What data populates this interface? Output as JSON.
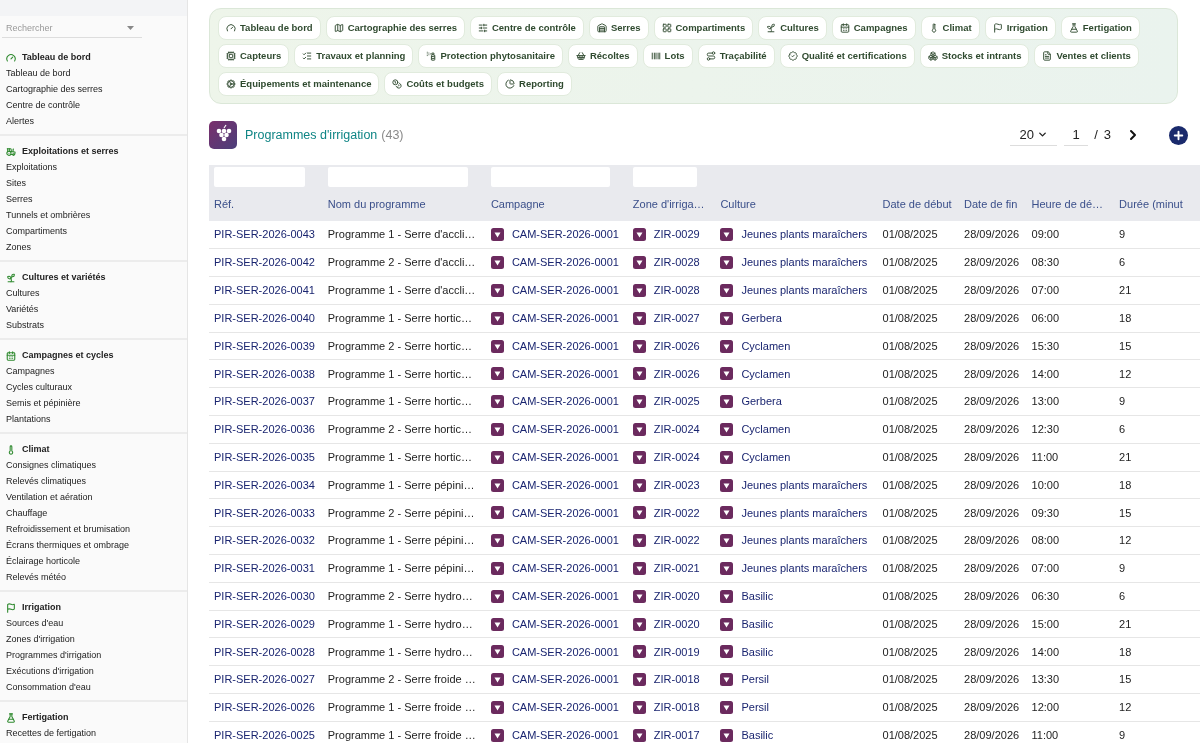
{
  "sidebar": {
    "search_placeholder": "Rechercher",
    "sections": [
      {
        "title": "Tableau de bord",
        "items": [
          "Tableau de bord",
          "Cartographie des serres",
          "Centre de contrôle",
          "Alertes"
        ]
      },
      {
        "title": "Exploitations et serres",
        "items": [
          "Exploitations",
          "Sites",
          "Serres",
          "Tunnels et ombrières",
          "Compartiments",
          "Zones"
        ]
      },
      {
        "title": "Cultures et variétés",
        "items": [
          "Cultures",
          "Variétés",
          "Substrats"
        ]
      },
      {
        "title": "Campagnes et cycles",
        "items": [
          "Campagnes",
          "Cycles culturaux",
          "Semis et pépinière",
          "Plantations"
        ]
      },
      {
        "title": "Climat",
        "items": [
          "Consignes climatiques",
          "Relevés climatiques",
          "Ventilation et aération",
          "Chauffage",
          "Refroidissement et brumisation",
          "Écrans thermiques et ombrage",
          "Éclairage horticole",
          "Relevés météo"
        ]
      },
      {
        "title": "Irrigation",
        "items": [
          "Sources d'eau",
          "Zones d'irrigation",
          "Programmes d'irrigation",
          "Exécutions d'irrigation",
          "Consommation d'eau"
        ]
      },
      {
        "title": "Fertigation",
        "items": [
          "Recettes de fertigation"
        ]
      }
    ]
  },
  "nav_pills": [
    "Tableau de bord",
    "Cartographie des serres",
    "Centre de contrôle",
    "Serres",
    "Compartiments",
    "Cultures",
    "Campagnes",
    "Climat",
    "Irrigation",
    "Fertigation",
    "Capteurs",
    "Travaux et planning",
    "Protection phytosanitaire",
    "Récoltes",
    "Lots",
    "Traçabilité",
    "Qualité et certifications",
    "Stocks et intrants",
    "Ventes et clients",
    "Équipements et maintenance",
    "Coûts et budgets",
    "Reporting"
  ],
  "page": {
    "title": "Programmes d'irrigation",
    "count": "(43)",
    "page_size": "20",
    "page": "1",
    "separator": "/",
    "total_pages": "3"
  },
  "table": {
    "columns": [
      {
        "label": "Réf.",
        "filter": true
      },
      {
        "label": "Nom du programme",
        "filter": true
      },
      {
        "label": "Campagne",
        "filter": true
      },
      {
        "label": "Zone d'irriga…",
        "filter": true
      },
      {
        "label": "Culture",
        "filter": false
      },
      {
        "label": "Date de début",
        "filter": false
      },
      {
        "label": "Date de fin",
        "filter": false
      },
      {
        "label": "Heure de dé…",
        "filter": false
      },
      {
        "label": "Durée (minut",
        "filter": false
      }
    ],
    "rows": [
      {
        "ref": "PIR-SER-2026-0043",
        "name": "Programme 1 - Serre d'accli…",
        "campaign": "CAM-SER-2026-0001",
        "zone": "ZIR-0029",
        "culture": "Jeunes plants maraîchers",
        "start": "01/08/2025",
        "end": "28/09/2026",
        "time": "09:00",
        "duration": "9"
      },
      {
        "ref": "PIR-SER-2026-0042",
        "name": "Programme 2 - Serre d'accli…",
        "campaign": "CAM-SER-2026-0001",
        "zone": "ZIR-0028",
        "culture": "Jeunes plants maraîchers",
        "start": "01/08/2025",
        "end": "28/09/2026",
        "time": "08:30",
        "duration": "6"
      },
      {
        "ref": "PIR-SER-2026-0041",
        "name": "Programme 1 - Serre d'accli…",
        "campaign": "CAM-SER-2026-0001",
        "zone": "ZIR-0028",
        "culture": "Jeunes plants maraîchers",
        "start": "01/08/2025",
        "end": "28/09/2026",
        "time": "07:00",
        "duration": "21"
      },
      {
        "ref": "PIR-SER-2026-0040",
        "name": "Programme 1 - Serre hortic…",
        "campaign": "CAM-SER-2026-0001",
        "zone": "ZIR-0027",
        "culture": "Gerbera",
        "start": "01/08/2025",
        "end": "28/09/2026",
        "time": "06:00",
        "duration": "18"
      },
      {
        "ref": "PIR-SER-2026-0039",
        "name": "Programme 2 - Serre hortic…",
        "campaign": "CAM-SER-2026-0001",
        "zone": "ZIR-0026",
        "culture": "Cyclamen",
        "start": "01/08/2025",
        "end": "28/09/2026",
        "time": "15:30",
        "duration": "15"
      },
      {
        "ref": "PIR-SER-2026-0038",
        "name": "Programme 1 - Serre hortic…",
        "campaign": "CAM-SER-2026-0001",
        "zone": "ZIR-0026",
        "culture": "Cyclamen",
        "start": "01/08/2025",
        "end": "28/09/2026",
        "time": "14:00",
        "duration": "12"
      },
      {
        "ref": "PIR-SER-2026-0037",
        "name": "Programme 1 - Serre hortic…",
        "campaign": "CAM-SER-2026-0001",
        "zone": "ZIR-0025",
        "culture": "Gerbera",
        "start": "01/08/2025",
        "end": "28/09/2026",
        "time": "13:00",
        "duration": "9"
      },
      {
        "ref": "PIR-SER-2026-0036",
        "name": "Programme 2 - Serre hortic…",
        "campaign": "CAM-SER-2026-0001",
        "zone": "ZIR-0024",
        "culture": "Cyclamen",
        "start": "01/08/2025",
        "end": "28/09/2026",
        "time": "12:30",
        "duration": "6"
      },
      {
        "ref": "PIR-SER-2026-0035",
        "name": "Programme 1 - Serre hortic…",
        "campaign": "CAM-SER-2026-0001",
        "zone": "ZIR-0024",
        "culture": "Cyclamen",
        "start": "01/08/2025",
        "end": "28/09/2026",
        "time": "11:00",
        "duration": "21"
      },
      {
        "ref": "PIR-SER-2026-0034",
        "name": "Programme 1 - Serre pépini…",
        "campaign": "CAM-SER-2026-0001",
        "zone": "ZIR-0023",
        "culture": "Jeunes plants maraîchers",
        "start": "01/08/2025",
        "end": "28/09/2026",
        "time": "10:00",
        "duration": "18"
      },
      {
        "ref": "PIR-SER-2026-0033",
        "name": "Programme 2 - Serre pépini…",
        "campaign": "CAM-SER-2026-0001",
        "zone": "ZIR-0022",
        "culture": "Jeunes plants maraîchers",
        "start": "01/08/2025",
        "end": "28/09/2026",
        "time": "09:30",
        "duration": "15"
      },
      {
        "ref": "PIR-SER-2026-0032",
        "name": "Programme 1 - Serre pépini…",
        "campaign": "CAM-SER-2026-0001",
        "zone": "ZIR-0022",
        "culture": "Jeunes plants maraîchers",
        "start": "01/08/2025",
        "end": "28/09/2026",
        "time": "08:00",
        "duration": "12"
      },
      {
        "ref": "PIR-SER-2026-0031",
        "name": "Programme 1 - Serre pépini…",
        "campaign": "CAM-SER-2026-0001",
        "zone": "ZIR-0021",
        "culture": "Jeunes plants maraîchers",
        "start": "01/08/2025",
        "end": "28/09/2026",
        "time": "07:00",
        "duration": "9"
      },
      {
        "ref": "PIR-SER-2026-0030",
        "name": "Programme 2 - Serre hydro…",
        "campaign": "CAM-SER-2026-0001",
        "zone": "ZIR-0020",
        "culture": "Basilic",
        "start": "01/08/2025",
        "end": "28/09/2026",
        "time": "06:30",
        "duration": "6"
      },
      {
        "ref": "PIR-SER-2026-0029",
        "name": "Programme 1 - Serre hydro…",
        "campaign": "CAM-SER-2026-0001",
        "zone": "ZIR-0020",
        "culture": "Basilic",
        "start": "01/08/2025",
        "end": "28/09/2026",
        "time": "15:00",
        "duration": "21"
      },
      {
        "ref": "PIR-SER-2026-0028",
        "name": "Programme 1 - Serre hydro…",
        "campaign": "CAM-SER-2026-0001",
        "zone": "ZIR-0019",
        "culture": "Basilic",
        "start": "01/08/2025",
        "end": "28/09/2026",
        "time": "14:00",
        "duration": "18"
      },
      {
        "ref": "PIR-SER-2026-0027",
        "name": "Programme 2 - Serre froide …",
        "campaign": "CAM-SER-2026-0001",
        "zone": "ZIR-0018",
        "culture": "Persil",
        "start": "01/08/2025",
        "end": "28/09/2026",
        "time": "13:30",
        "duration": "15"
      },
      {
        "ref": "PIR-SER-2026-0026",
        "name": "Programme 1 - Serre froide …",
        "campaign": "CAM-SER-2026-0001",
        "zone": "ZIR-0018",
        "culture": "Persil",
        "start": "01/08/2025",
        "end": "28/09/2026",
        "time": "12:00",
        "duration": "12"
      },
      {
        "ref": "PIR-SER-2026-0025",
        "name": "Programme 1 - Serre froide …",
        "campaign": "CAM-SER-2026-0001",
        "zone": "ZIR-0017",
        "culture": "Basilic",
        "start": "01/08/2025",
        "end": "28/09/2026",
        "time": "11:00",
        "duration": "9"
      }
    ]
  }
}
